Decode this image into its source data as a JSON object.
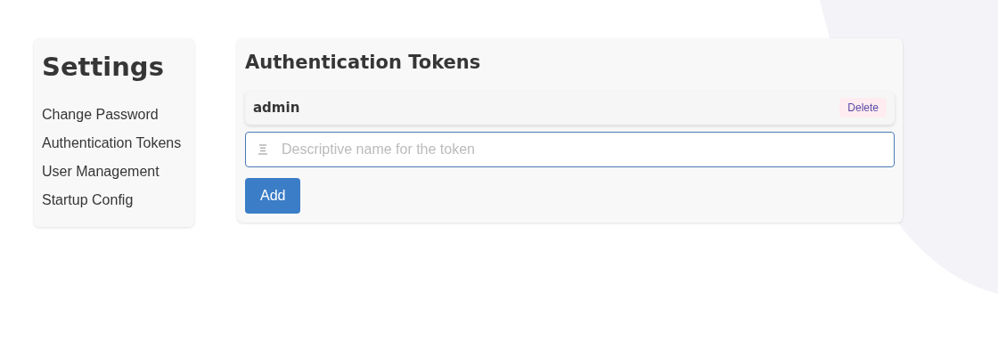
{
  "sidebar": {
    "title": "Settings",
    "items": [
      {
        "label": "Change Password"
      },
      {
        "label": "Authentication Tokens"
      },
      {
        "label": "User Management"
      },
      {
        "label": "Startup Config"
      }
    ]
  },
  "panel": {
    "title": "Authentication Tokens",
    "tokens": [
      {
        "name": "admin",
        "action": "Delete"
      }
    ],
    "input": {
      "placeholder": "Descriptive name for the token"
    },
    "button": "Add"
  }
}
